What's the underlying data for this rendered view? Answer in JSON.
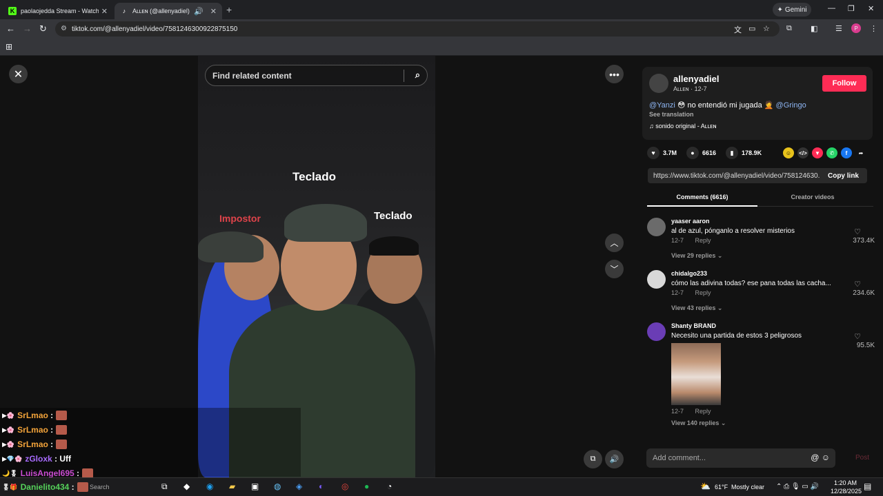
{
  "browser": {
    "tabs": [
      {
        "title": "paolaojedda Stream - Watch Li",
        "favicon": "K"
      },
      {
        "title": "Aʟʟᴇɴ (@allenyadiel) | TikTo",
        "favicon": "♪"
      }
    ],
    "gemini_label": "Gemini",
    "url": "tiktok.com/@allenyadiel/video/7581246300922875150"
  },
  "video": {
    "search_placeholder": "Find related content",
    "overlay_texts": {
      "top": "Teclado",
      "left": "Impostor",
      "right": "Teclado"
    }
  },
  "chat": [
    {
      "user": "SrLmao",
      "color": "#f2a33a",
      "text": ""
    },
    {
      "user": "SrLmao",
      "color": "#f2a33a",
      "text": ""
    },
    {
      "user": "SrLmao",
      "color": "#f2a33a",
      "text": ""
    },
    {
      "user": "zGloxk",
      "color": "#a86bff",
      "text": "Uff"
    },
    {
      "user": "LuisAngel695",
      "color": "#c94cd1",
      "text": ""
    },
    {
      "user": "Danielito434",
      "color": "#55d15a",
      "text": ""
    }
  ],
  "post": {
    "username": "allenyadiel",
    "display": "Aʟʟᴇɴ · 12-7",
    "follow_label": "Follow",
    "caption_mention1": "@Yanzi",
    "caption_text": "no entendió mi jugada",
    "caption_mention2": "@Gringo",
    "see_translation": "See translation",
    "sound": "sonido original - Aʟʟᴇɴ",
    "likes": "3.7M",
    "comments": "6616",
    "saves": "178.9K",
    "link": "https://www.tiktok.com/@allenyadiel/video/758124630...",
    "copy_label": "Copy link"
  },
  "panel_tabs": {
    "comments": "Comments (6616)",
    "creator": "Creator videos"
  },
  "comments": [
    {
      "user": "yaaser aaron",
      "text": "al de azul, pónganlo a resolver misterios",
      "date": "12-7",
      "reply": "Reply",
      "likes": "373.4K",
      "replies": "View 29 replies"
    },
    {
      "user": "chidalgo233",
      "text": "cómo las adivina todas? ese pana todas las cacha...",
      "date": "12-7",
      "reply": "Reply",
      "likes": "234.6K",
      "replies": "View 43 replies"
    },
    {
      "user": "Shanty BRAND",
      "text": "Necesito una partida de estos 3 peligrosos",
      "date": "12-7",
      "reply": "Reply",
      "likes": "95.5K",
      "replies": "View 140 replies"
    }
  ],
  "add_comment": {
    "placeholder": "Add comment...",
    "post_label": "Post"
  },
  "taskbar": {
    "search": "Search",
    "weather": "61°F",
    "weather_desc": "Mostly clear",
    "time": "1:20 AM",
    "date": "12/28/2025"
  }
}
